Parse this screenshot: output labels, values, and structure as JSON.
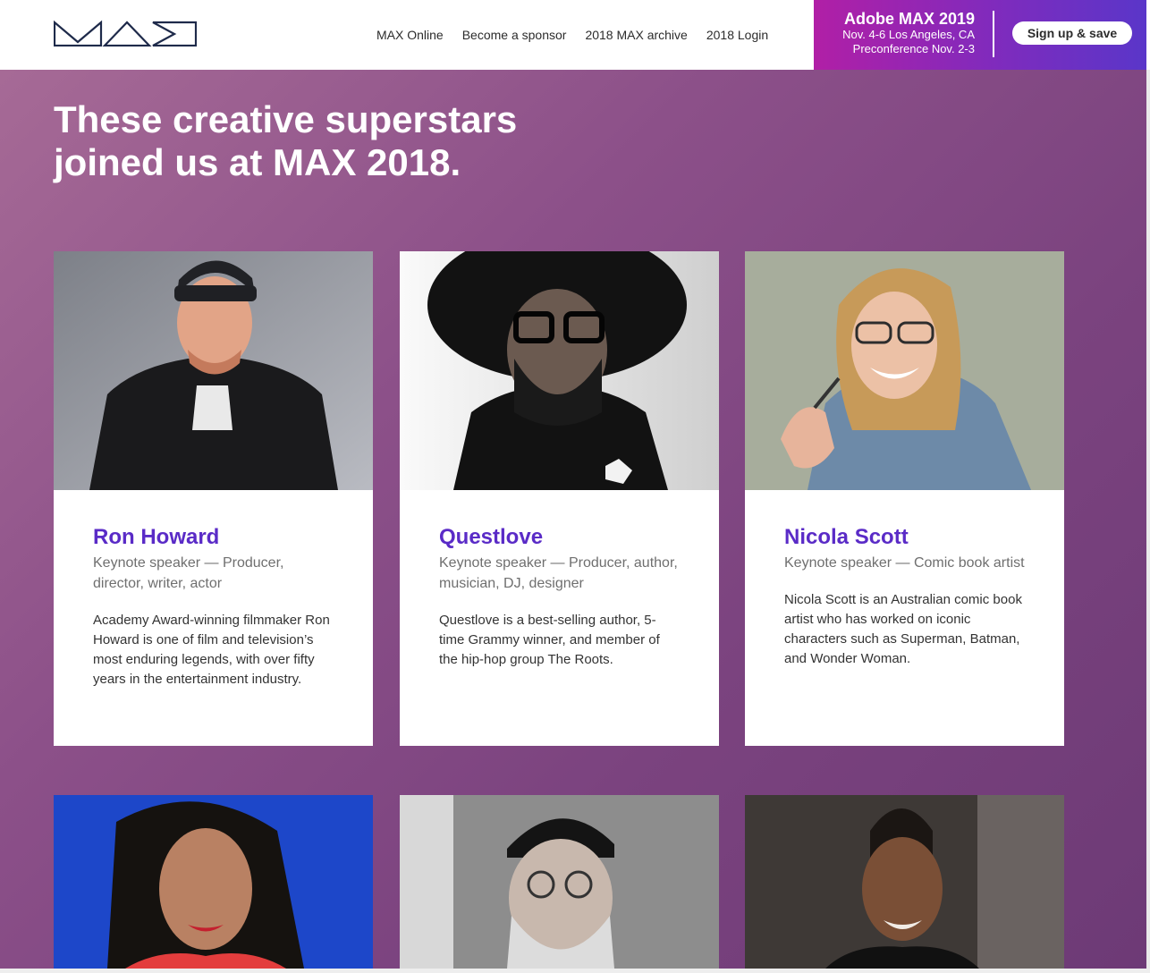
{
  "header": {
    "logo_text": "MAX",
    "nav": [
      {
        "label": "MAX Online"
      },
      {
        "label": "Become a sponsor"
      },
      {
        "label": "2018 MAX archive"
      },
      {
        "label": "2018 Login"
      }
    ],
    "promo": {
      "title": "Adobe MAX 2019",
      "line1": "Nov. 4-6 Los Angeles, CA",
      "line2": "Preconference Nov. 2-3",
      "button_label": "Sign up & save",
      "gradient_start": "#b11fa6",
      "gradient_end": "#5a36c9"
    }
  },
  "main": {
    "title_line1": "These creative superstars",
    "title_line2": "joined us at MAX 2018.",
    "accent_color": "#5a2bc7",
    "speakers": [
      {
        "name": "Ron Howard",
        "role": "Keynote speaker — Producer, director, writer, actor",
        "description": "Academy Award-winning filmmaker Ron Howard is one of film and television’s most enduring legends, with over fifty years in the entertainment industry."
      },
      {
        "name": "Questlove",
        "role": "Keynote speaker — Producer, author, musician, DJ, designer",
        "description": "Questlove is a best-selling author, 5-time Grammy winner, and member of the hip-hop group The Roots."
      },
      {
        "name": "Nicola Scott",
        "role": "Keynote speaker — Comic book artist",
        "description": "Nicola Scott is an Australian comic book artist who has worked on iconic characters such as Superman, Batman, and Wonder Woman."
      }
    ]
  }
}
